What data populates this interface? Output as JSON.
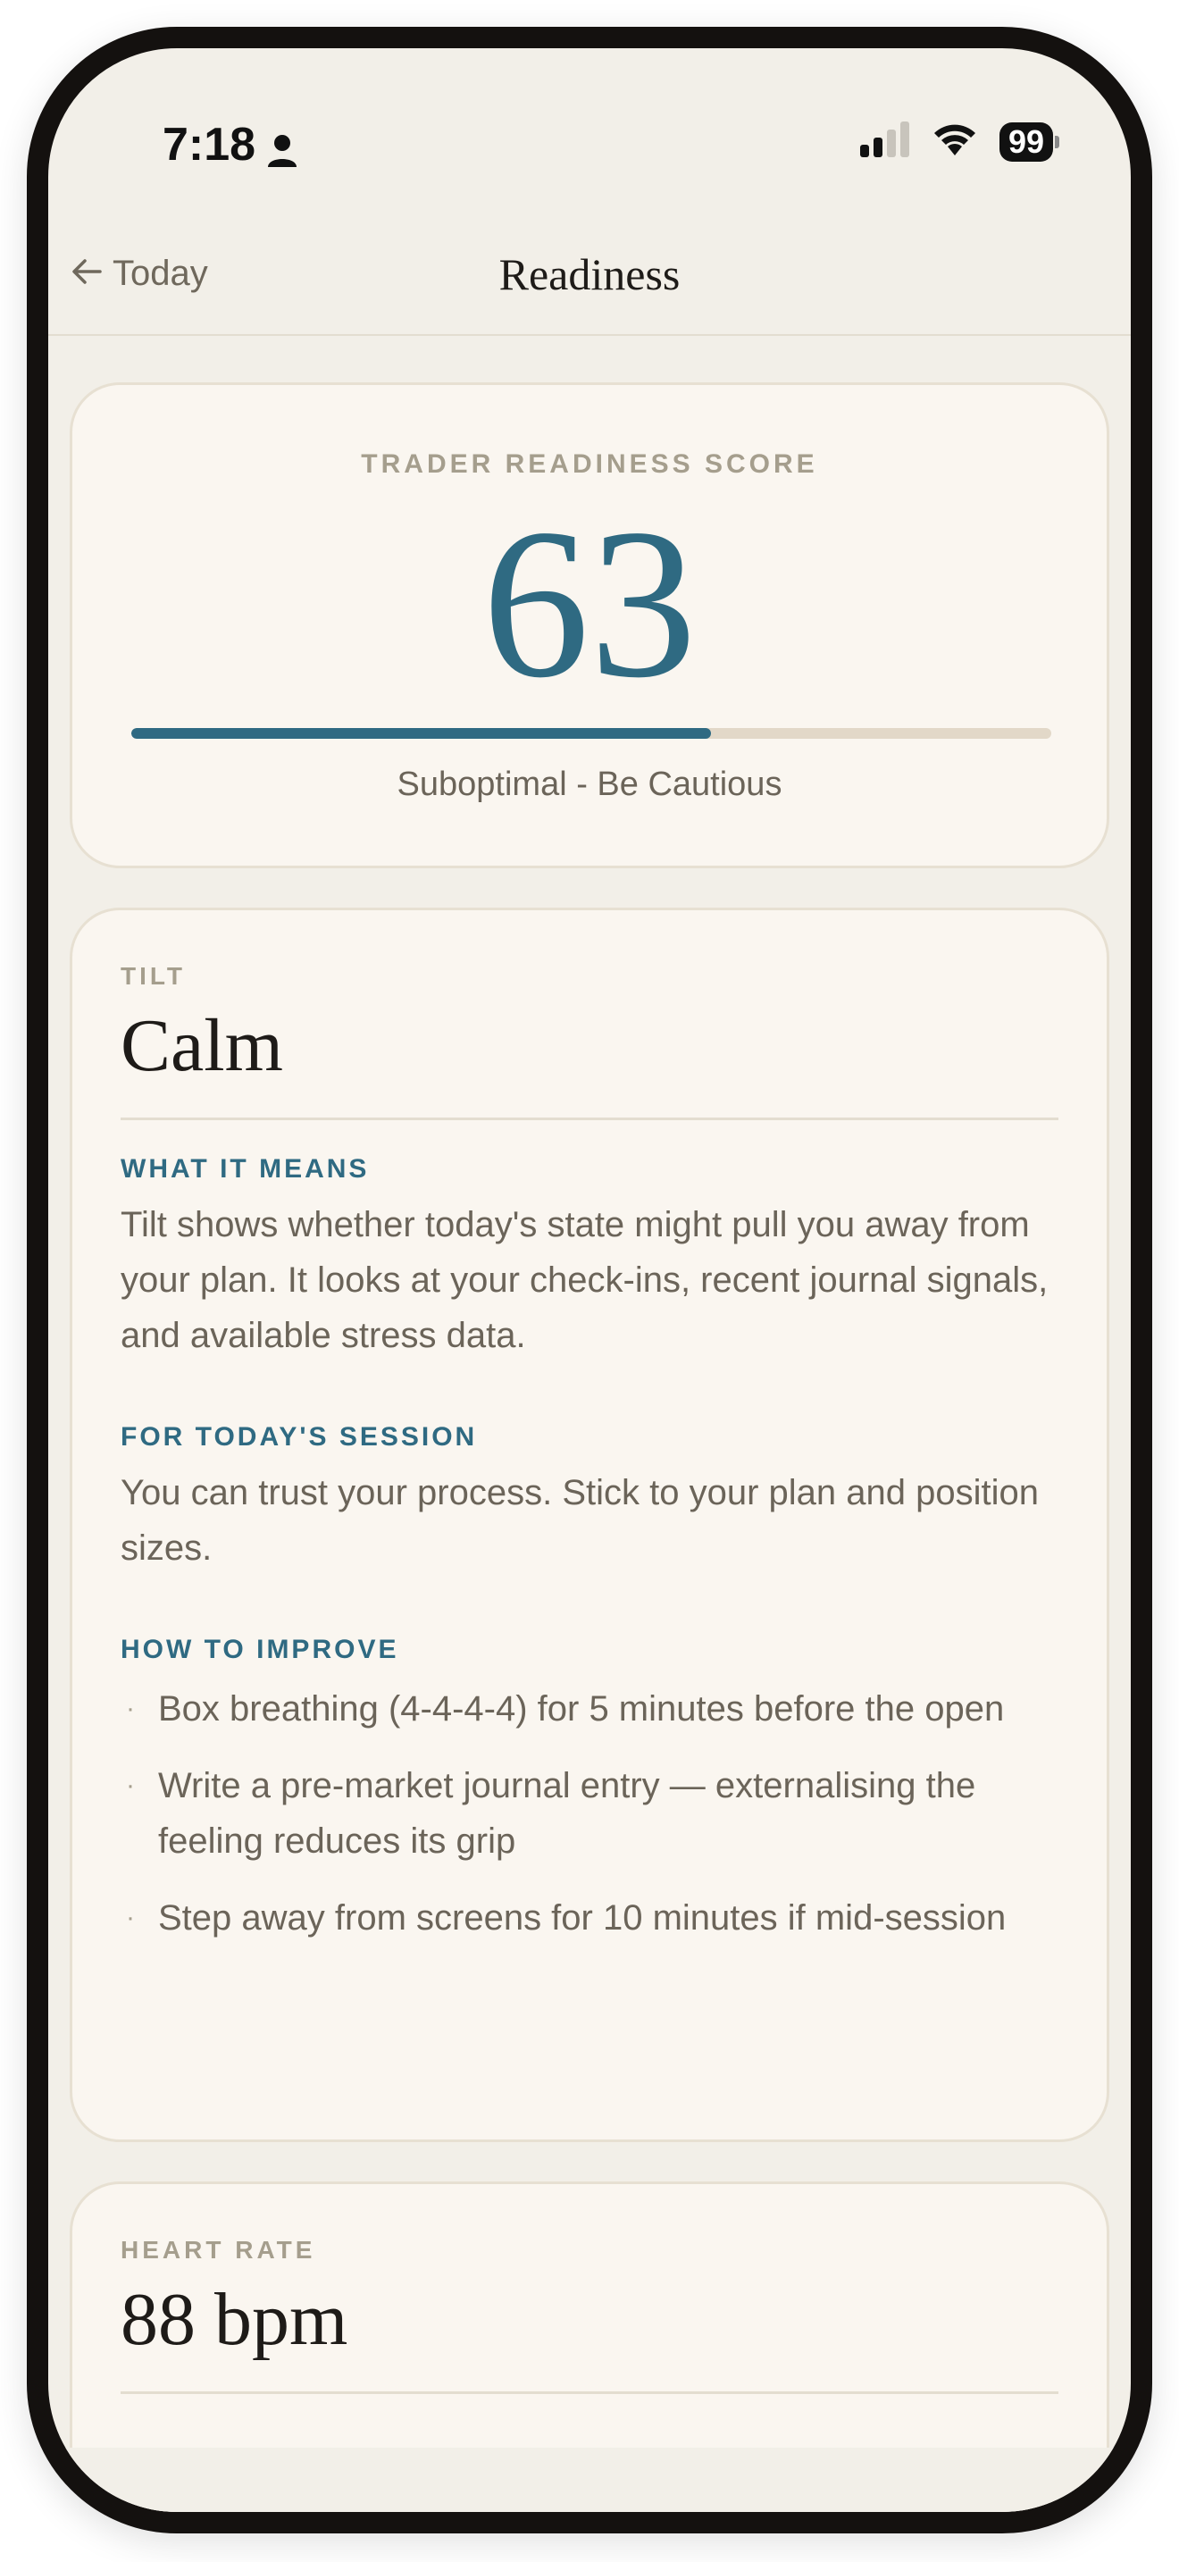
{
  "status_bar": {
    "time": "7:18",
    "battery": "99",
    "icons": [
      "person-icon",
      "signal-icon",
      "wifi-icon",
      "battery-icon"
    ]
  },
  "nav": {
    "back_label": "Today",
    "back_icon": "arrow-left-icon",
    "title": "Readiness"
  },
  "score": {
    "label": "TRADER READINESS SCORE",
    "value": "63",
    "progress": 0.63,
    "status": "Suboptimal - Be Cautious"
  },
  "tilt": {
    "label": "TILT",
    "value": "Calm",
    "what_it_means_heading": "WHAT IT MEANS",
    "what_it_means_text": "Tilt shows whether today's state might pull you away from your plan. It looks at your check-ins, recent journal signals, and available stress data.",
    "session_heading": "FOR TODAY'S SESSION",
    "session_text": "You can trust your process. Stick to your plan and position sizes.",
    "improve_heading": "HOW TO IMPROVE",
    "tips": [
      "Box breathing (4-4-4-4) for 5 minutes before the open",
      "Write a pre-market journal entry — externalising the feeling reduces its grip",
      "Step away from screens for 10 minutes if mid-session"
    ],
    "bullet": "·"
  },
  "heart_rate": {
    "label": "HEART RATE",
    "value": "88 bpm"
  },
  "colors": {
    "accent": "#2f6a82",
    "background": "#f2efe8",
    "card": "#faf6f0",
    "muted": "#a59e8d",
    "text": "#6b6459"
  }
}
